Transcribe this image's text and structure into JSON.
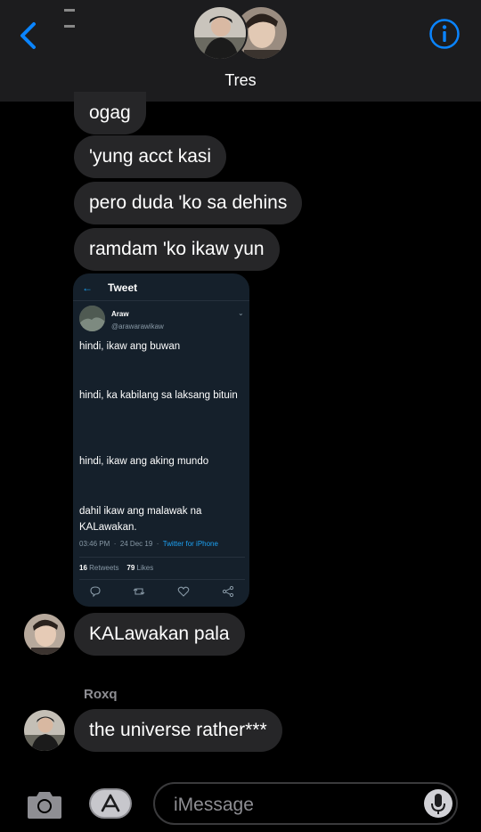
{
  "header": {
    "title": "Tres",
    "accent_color": "#0a84ff",
    "back_icon": "chevron-left-icon",
    "info_icon": "info-icon"
  },
  "messages": [
    {
      "text": "ogag"
    },
    {
      "text": "'yung acct kasi"
    },
    {
      "text": "pero duda 'ko sa dehins"
    },
    {
      "text": "ramdam 'ko ikaw yun"
    },
    {
      "text": "KALawakan pala"
    },
    {
      "text": "the universe rather***"
    }
  ],
  "sender_name": "Roxq",
  "tweet": {
    "header_title": "Tweet",
    "name": "Araw",
    "handle": "@arawarawikaw",
    "lines": [
      "hindi, ikaw ang buwan",
      "hindi, ka kabilang sa laksang bituin",
      "hindi, ikaw ang aking mundo",
      "dahil ikaw ang malawak na KALawakan."
    ],
    "time": "03:46 PM",
    "date": "24 Dec 19",
    "source": "Twitter for iPhone",
    "retweets_count": "16",
    "retweets_label": "Retweets",
    "likes_count": "79",
    "likes_label": "Likes",
    "action_icons": [
      "reply-icon",
      "retweet-icon",
      "like-icon",
      "share-icon"
    ]
  },
  "composer": {
    "placeholder": "iMessage",
    "camera_icon": "camera-icon",
    "apps_icon": "app-store-icon",
    "mic_icon": "microphone-icon"
  }
}
